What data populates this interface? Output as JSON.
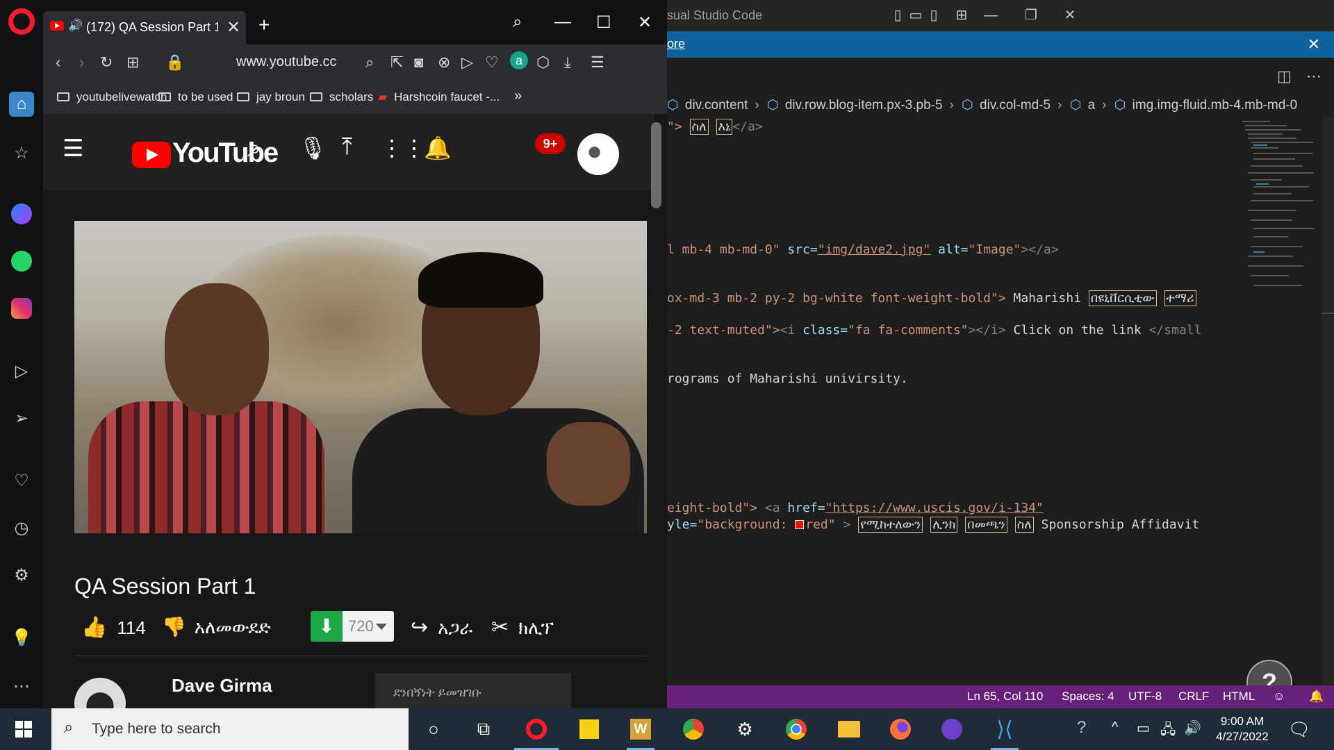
{
  "vscode": {
    "title": "sual Studio Code",
    "notice_link": "ore",
    "breadcrumb": [
      "div.content",
      "div.row.blog-item.px-3.pb-5",
      "div.col-md-5",
      "a",
      "img.img-fluid.mb-4.mb-md-0"
    ],
    "code": {
      "l1_a": "\">",
      "l1_b": "ስለ",
      "l1_c": "እኔ",
      "l1_d": "</a>",
      "l2_a": "l mb-4 mb-md-0\"",
      "l2_attr1": "src=",
      "l2_str1": "\"img/dave2.jpg\"",
      "l2_attr2": "alt=",
      "l2_str2": "\"Image\"",
      "l2_end": "></a>",
      "l3_a": "ox-md-3 mb-2 py-2 bg-white font-weight-bold\">",
      "l3_b": " Maharishi ",
      "l3_c": "በዩኒቨርሲቲው",
      "l3_d": "ተማሪ",
      "l4_a": "-2 text-muted\">",
      "l4_b": "<i",
      "l4_attr": " class=",
      "l4_str": "\"fa fa-comments\"",
      "l4_c": "></i>",
      "l4_d": " Click on the link ",
      "l4_e": "</small",
      "l5": "rograms of Maharishi univirsity.",
      "l6_a": "eight-bold\">",
      "l6_b": " <a",
      "l6_attr": " href=",
      "l6_str": "\"https://www.uscis.gov/i-134\"",
      "l7_attr": "yle=",
      "l7_str1": "\"background: ",
      "l7_str2": "red\"",
      "l7_b": " > ",
      "l7_c": "የሚከተለውን",
      "l7_d": "ሊንክ",
      "l7_e": "በመጫን",
      "l7_f": "ስለ",
      "l7_g": " Sponsorship Affidavit"
    },
    "status": {
      "position": "Ln 65, Col 110",
      "spaces": "Spaces: 4",
      "encoding": "UTF-8",
      "eol": "CRLF",
      "language": "HTML"
    },
    "help_glyph": "?",
    "colors": {
      "status_bar": "#68217a",
      "notice": "#0e639c"
    }
  },
  "browser": {
    "tab_title": "(172) QA Session Part 1",
    "url": "www.youtube.cc",
    "bookmarks": [
      "youtubelivewatch",
      "to be used",
      "jay broun",
      "scholars",
      "Harshcoin faucet -..."
    ],
    "more_bookmarks": "»"
  },
  "youtube": {
    "logo_text": "YouTube",
    "notification_count": "9+",
    "video_title": "QA Session Part 1",
    "likes": "114",
    "dislike_label": "አለመውደድ",
    "download_quality": "720",
    "share_label": "አጋራ",
    "clip_label": "ክሊፕ",
    "channel_name": "Dave Girma",
    "subscribe_text": "ደንበኝነት ይመዝገቡ"
  },
  "taskbar": {
    "search_placeholder": "Type here to search",
    "time": "9:00 AM",
    "date": "4/27/2022"
  }
}
